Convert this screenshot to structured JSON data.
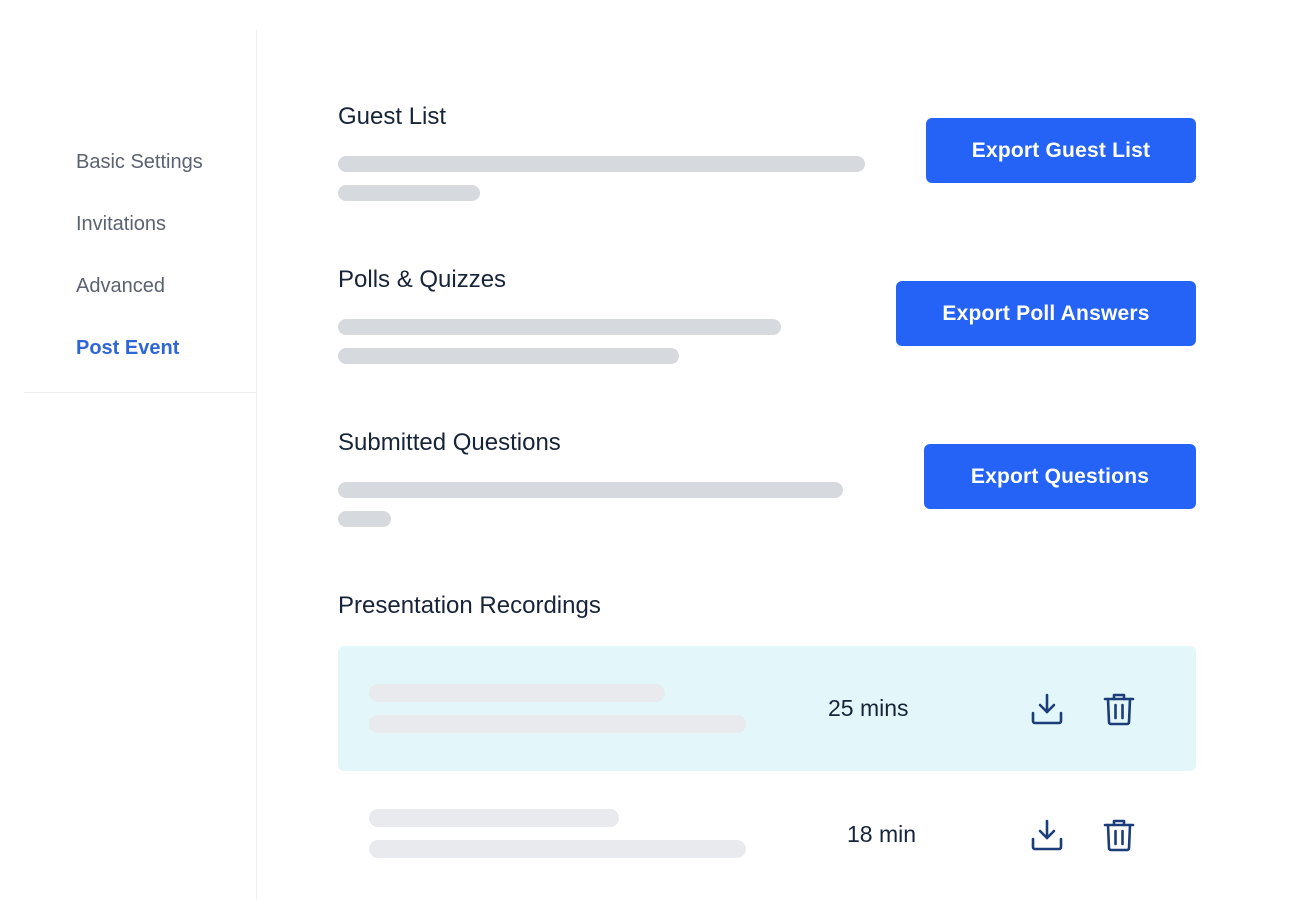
{
  "sidebar": {
    "items": [
      {
        "label": "Basic Settings",
        "active": false
      },
      {
        "label": "Invitations",
        "active": false
      },
      {
        "label": "Advanced",
        "active": false
      },
      {
        "label": "Post Event",
        "active": true
      }
    ]
  },
  "sections": {
    "guest_list": {
      "title": "Guest List",
      "button_label": "Export Guest List"
    },
    "polls": {
      "title": "Polls & Quizzes",
      "button_label": "Export Poll Answers"
    },
    "questions": {
      "title": "Submitted Questions",
      "button_label": "Export Questions"
    },
    "recordings": {
      "title": "Presentation Recordings",
      "items": [
        {
          "duration": "25 mins",
          "download_icon": "download-icon",
          "delete_icon": "trash-icon",
          "highlighted": true
        },
        {
          "duration": "18 min",
          "download_icon": "download-icon",
          "delete_icon": "trash-icon",
          "highlighted": false
        }
      ]
    }
  },
  "colors": {
    "accent": "#2563f6",
    "active_nav": "#2f66d6",
    "highlight_row": "#e3f7fa",
    "skeleton": "#d6d9de",
    "icon": "#1b3d7a"
  }
}
